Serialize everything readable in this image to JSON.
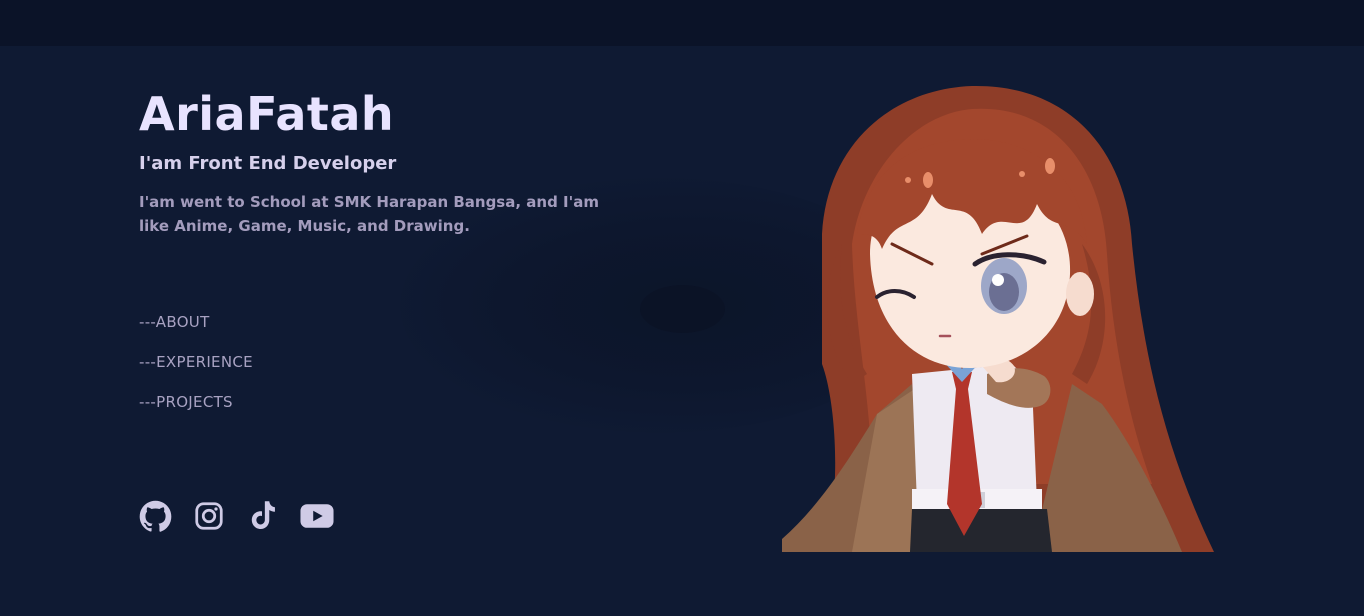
{
  "hero": {
    "name": "AriaFatah",
    "role": "I'am Front End Developer",
    "bio": "I'am went to School at SMK Harapan Bangsa, and I'am like Anime, Game, Music, and Drawing."
  },
  "nav": {
    "items": [
      {
        "label": "---ABOUT"
      },
      {
        "label": "---EXPERIENCE"
      },
      {
        "label": "---PROJECTS"
      }
    ]
  },
  "socials": [
    {
      "icon": "github-icon"
    },
    {
      "icon": "instagram-icon"
    },
    {
      "icon": "tiktok-icon"
    },
    {
      "icon": "youtube-icon"
    }
  ],
  "colors": {
    "background": "#0f1a33",
    "topbar": "#0b1328",
    "heading": "#e8e3ff",
    "text": "#a39cbd",
    "icon": "#cfcbe6"
  }
}
